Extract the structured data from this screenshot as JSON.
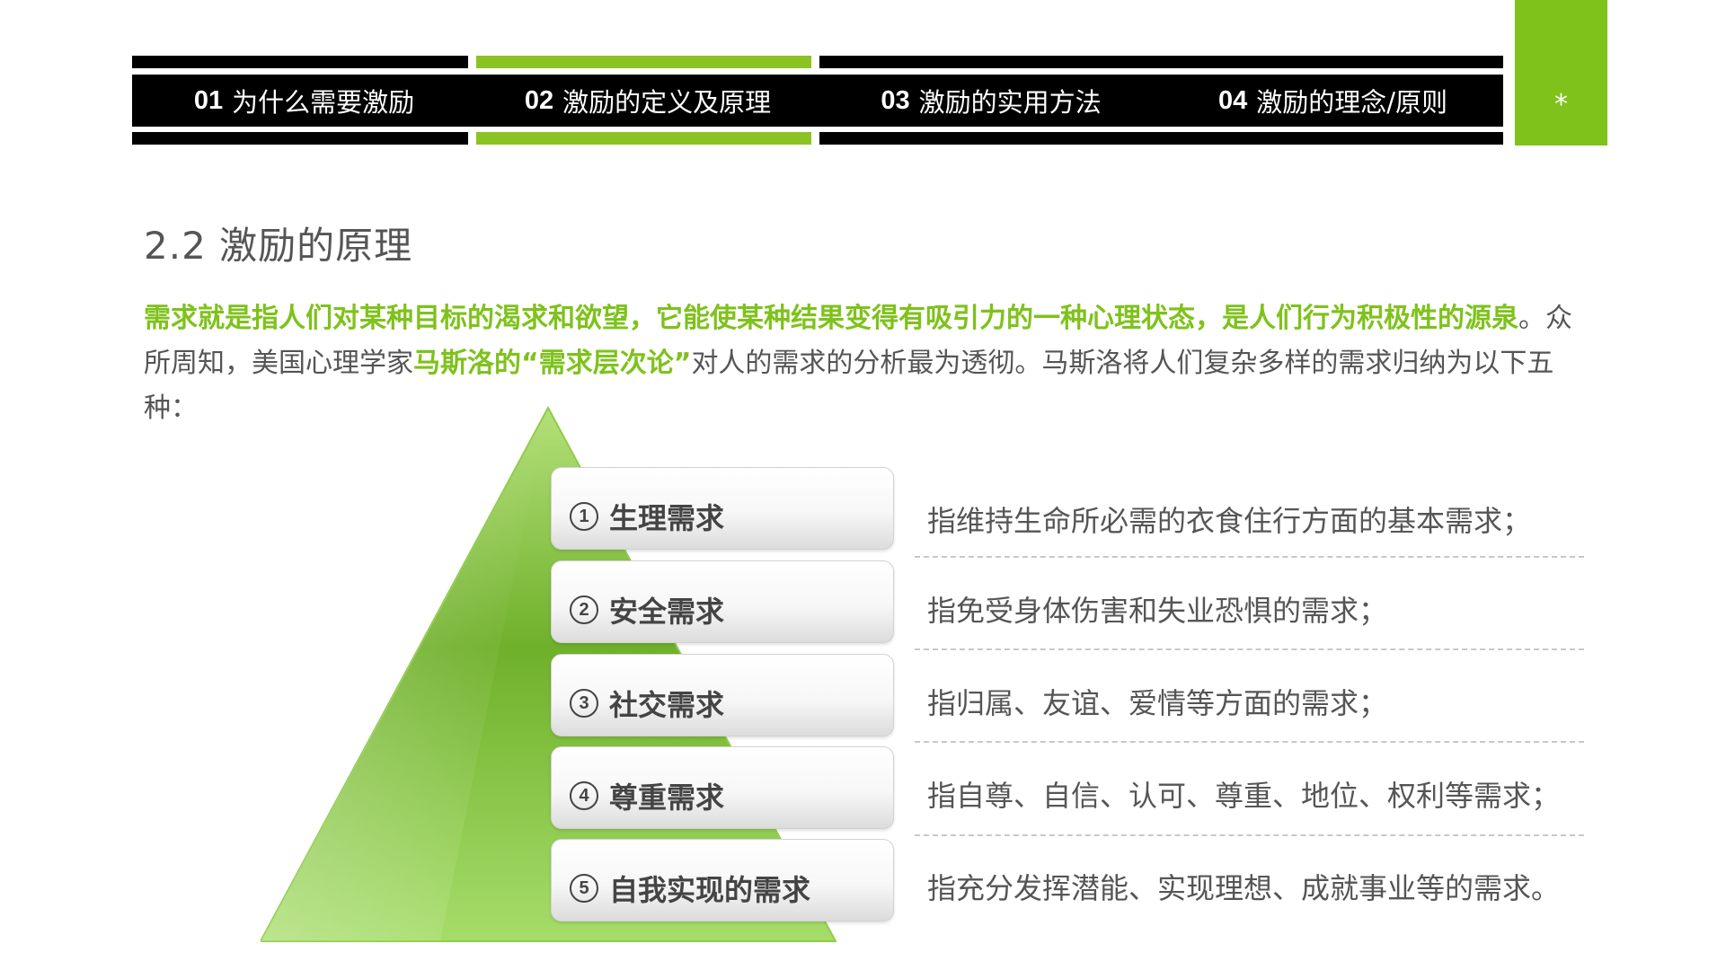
{
  "nav": {
    "items": [
      {
        "num": "01",
        "label": "为什么需要激励"
      },
      {
        "num": "02",
        "label": "激励的定义及原理"
      },
      {
        "num": "03",
        "label": "激励的实用方法"
      },
      {
        "num": "04",
        "label": "激励的理念/原则"
      }
    ],
    "corner_mark": "*"
  },
  "section_title": "2.2  激励的原理",
  "intro": {
    "p1_highlight": "需求就是指人们对某种目标的渴求和欲望，它能使某种结果变得有吸引力的一种心理状态，是人们行为积极性的源泉",
    "p2": "。众所周知，美国心理学家",
    "p3_highlight": "马斯洛的“需求层次论”",
    "p4": "对人的需求的分析最为透彻。马斯洛将人们复杂多样的需求归纳为以下五种："
  },
  "levels": [
    {
      "index": "1",
      "label": "生理需求",
      "desc": "指维持生命所必需的衣食住行方面的基本需求；"
    },
    {
      "index": "2",
      "label": "安全需求",
      "desc": "指免受身体伤害和失业恐惧的需求；"
    },
    {
      "index": "3",
      "label": "社交需求",
      "desc": "指归属、友谊、爱情等方面的需求；"
    },
    {
      "index": "4",
      "label": "尊重需求",
      "desc": "指自尊、自信、认可、尊重、地位、权利等需求；"
    },
    {
      "index": "5",
      "label": "自我实现的需求",
      "desc": "指充分发挥潜能、实现理想、成就事业等的需求。"
    }
  ],
  "colors": {
    "accent": "#7ec21b",
    "nav_active": "#8cc324",
    "nav_bg": "#000000"
  },
  "active_nav_index": 1
}
